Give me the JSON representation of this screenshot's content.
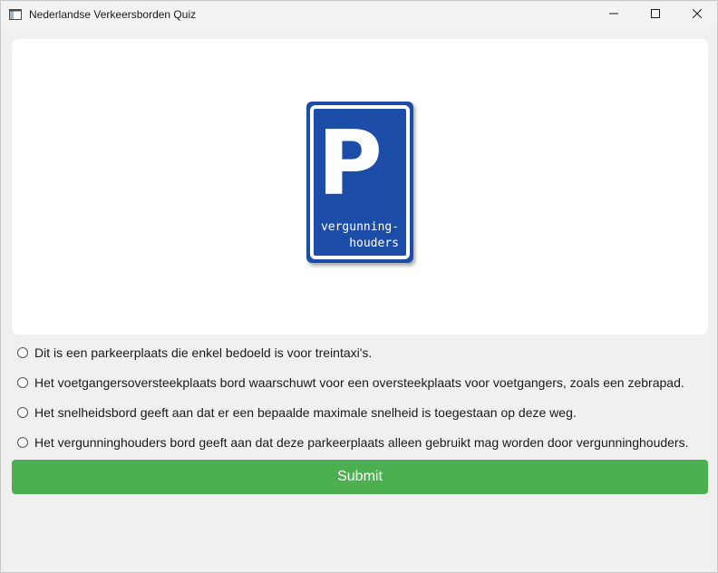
{
  "window": {
    "title": "Nederlandse Verkeersborden Quiz",
    "controls": {
      "minimize": "minimize-icon",
      "maximize": "maximize-icon",
      "close": "close-icon"
    }
  },
  "sign": {
    "letter": "P",
    "line1": "vergunning-",
    "line2": "houders",
    "colors": {
      "blue": "#1f4ea8",
      "white": "#ffffff"
    }
  },
  "options": [
    {
      "label": "Dit is een parkeerplaats die enkel bedoeld is voor treintaxi's.",
      "selected": false
    },
    {
      "label": "Het voetgangersoversteekplaats bord waarschuwt voor een oversteekplaats voor voetgangers, zoals een zebrapad.",
      "selected": false
    },
    {
      "label": "Het snelheidsbord geeft aan dat er een bepaalde maximale snelheid is toegestaan op deze weg.",
      "selected": false
    },
    {
      "label": "Het vergunninghouders bord geeft aan dat deze parkeerplaats alleen gebruikt mag worden door vergunninghouders.",
      "selected": false
    }
  ],
  "submit": {
    "label": "Submit",
    "color": "#4caf50"
  }
}
